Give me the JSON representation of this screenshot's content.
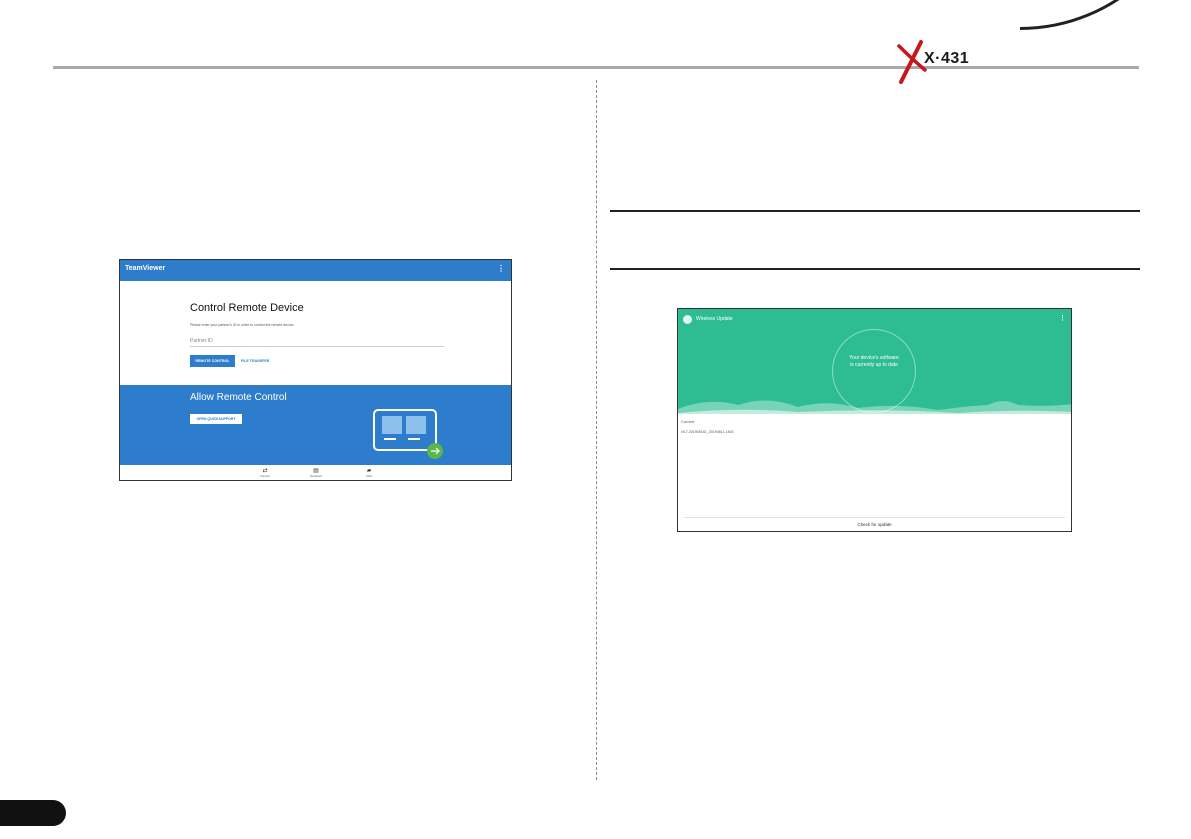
{
  "header": {
    "logo_text": "X·431"
  },
  "teamviewer": {
    "app_title": "TeamViewer",
    "menu_icon": "more-vert-icon",
    "heading": "Control Remote Device",
    "description": "Please enter your partner's ID in order to control the remote device.",
    "partner_placeholder": "Partner ID",
    "remote_control_label": "REMOTE CONTROL",
    "file_transfer_label": "FILE TRANSFER",
    "allow_heading": "Allow Remote Control",
    "quicksupport_label": "OPEN QUICKSUPPORT",
    "colors": {
      "brand_blue": "#2e7ccc"
    },
    "nav": [
      {
        "label": "Connect",
        "icon": "swap-arrows-icon"
      },
      {
        "label": "Computers",
        "icon": "document-icon"
      },
      {
        "label": "Chat",
        "icon": "chat-icon"
      }
    ]
  },
  "wireless_update": {
    "app_title": "Wireless Update",
    "menu_icon": "more-vert-icon",
    "status_line_1": "Your device's software",
    "status_line_2": "is currently up to date",
    "current_label": "Current",
    "version": "v5.7.201905161_20190611.1453",
    "check_label": "Check for update",
    "colors": {
      "accent_green": "#2ebd93"
    }
  }
}
